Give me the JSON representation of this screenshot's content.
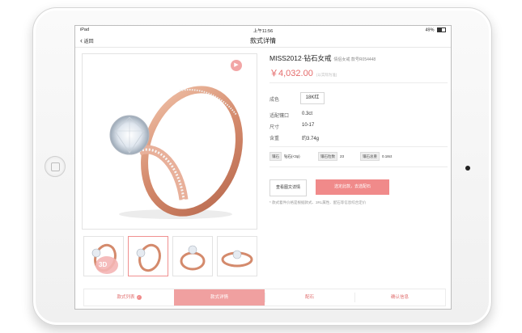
{
  "status": {
    "device": "iPad",
    "time": "上午11:56",
    "battery": "49%"
  },
  "nav": {
    "back": "返回",
    "title": "款式详情"
  },
  "product": {
    "name": "MISS2012·钻石女戒",
    "subtitle": "情侣女戒 款号R054448",
    "price": "￥4,032.00",
    "price_note": "(以实际为准)"
  },
  "specs": [
    {
      "label": "成色",
      "value": "18K红"
    },
    {
      "label": "适配镶口",
      "value": "0.3ct"
    },
    {
      "label": "尺寸",
      "value": "10-17"
    },
    {
      "label": "含重",
      "value": "约3.74g"
    }
  ],
  "tags": [
    {
      "key": "镶石",
      "value": "钻石(<3p)"
    },
    {
      "key": "镶石粒数",
      "value": "23"
    },
    {
      "key": "镶石总重",
      "value": "0.18ct"
    }
  ],
  "buttons": {
    "detail": "查看图文详情",
    "customize": "选定此款，去选配石"
  },
  "note": "* 款式着件价格是根据款式、3RL属性、配石等信息综合定价",
  "thumb_badge": "3D",
  "tabs": [
    {
      "label": "款式列表",
      "badge": "✓"
    },
    {
      "label": "款式详情"
    },
    {
      "label": "配石"
    },
    {
      "label": "确认信息"
    }
  ],
  "colors": {
    "accent": "#f08a8a",
    "price": "#e46b6b",
    "ring": "#d99579"
  },
  "icons": {
    "play": "play-icon",
    "back": "chevron-left-icon",
    "wifi": "wifi-icon",
    "battery": "battery-icon"
  }
}
